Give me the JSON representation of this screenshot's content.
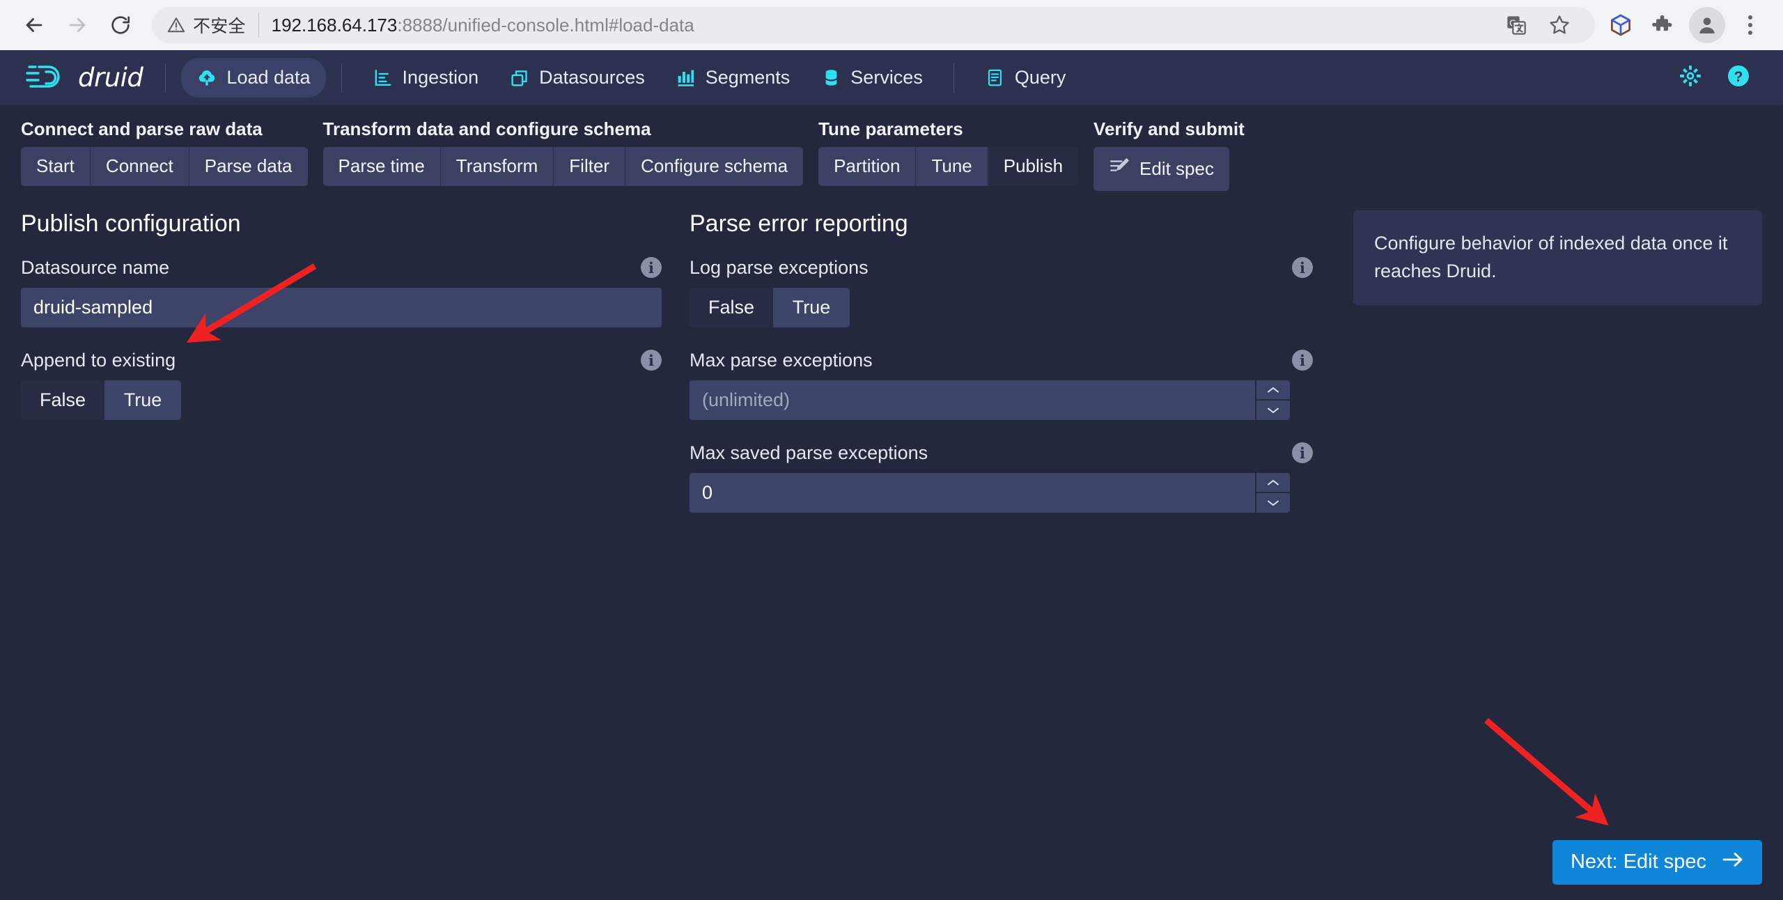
{
  "browser": {
    "back_label": "Back",
    "forward_label": "Forward",
    "reload_label": "Reload",
    "security_label": "不安全",
    "url_host": "192.168.64.173",
    "url_rest": ":8888/unified-console.html#load-data",
    "icons": {
      "translate": "translate-icon",
      "bookmark": "bookmark-star-icon",
      "cube": "cube-icon",
      "extensions": "puzzle-extensions-icon",
      "profile": "profile-avatar-icon",
      "menu": "three-dot-menu-icon"
    }
  },
  "navbar": {
    "brand": "druid",
    "items": [
      {
        "label": "Load data",
        "icon": "cloud-upload-icon",
        "active": true
      },
      {
        "label": "Ingestion",
        "icon": "ingestion-icon",
        "active": false
      },
      {
        "label": "Datasources",
        "icon": "datasources-icon",
        "active": false
      },
      {
        "label": "Segments",
        "icon": "segments-icon",
        "active": false
      },
      {
        "label": "Services",
        "icon": "services-icon",
        "active": false
      },
      {
        "label": "Query",
        "icon": "query-icon",
        "active": false
      }
    ],
    "settings_label": "Settings",
    "help_label": "Help"
  },
  "steps": {
    "groups": [
      {
        "title": "Connect and parse raw data",
        "buttons": [
          {
            "label": "Start",
            "active": false
          },
          {
            "label": "Connect",
            "active": false
          },
          {
            "label": "Parse data",
            "active": false
          }
        ]
      },
      {
        "title": "Transform data and configure schema",
        "buttons": [
          {
            "label": "Parse time",
            "active": false
          },
          {
            "label": "Transform",
            "active": false
          },
          {
            "label": "Filter",
            "active": false
          },
          {
            "label": "Configure schema",
            "active": false
          }
        ]
      },
      {
        "title": "Tune parameters",
        "buttons": [
          {
            "label": "Partition",
            "active": false
          },
          {
            "label": "Tune",
            "active": false
          },
          {
            "label": "Publish",
            "active": true
          }
        ]
      },
      {
        "title": "Verify and submit",
        "buttons": [
          {
            "label": "Edit spec",
            "active": false,
            "icon": "edit-spec-icon"
          }
        ]
      }
    ]
  },
  "publish": {
    "section_title": "Publish configuration",
    "datasource": {
      "label": "Datasource name",
      "value": "druid-sampled",
      "placeholder": ""
    },
    "append": {
      "label": "Append to existing",
      "options": [
        "False",
        "True"
      ],
      "selected": "False"
    }
  },
  "parse_errors": {
    "section_title": "Parse error reporting",
    "log_parse_exceptions": {
      "label": "Log parse exceptions",
      "options": [
        "False",
        "True"
      ],
      "selected": "True"
    },
    "max_parse_exceptions": {
      "label": "Max parse exceptions",
      "value": "",
      "placeholder": "(unlimited)"
    },
    "max_saved_parse_exceptions": {
      "label": "Max saved parse exceptions",
      "value": "0",
      "placeholder": ""
    }
  },
  "info_panel": {
    "text": "Configure behavior of indexed data once it reaches Druid."
  },
  "footer": {
    "next_label": "Next: Edit spec"
  },
  "colors": {
    "accent_cyan": "#2fe0ef",
    "primary_blue": "#0f86d7",
    "nav_bg": "#2c3150",
    "page_bg": "#23283c",
    "annotation_red": "#ee2222"
  }
}
